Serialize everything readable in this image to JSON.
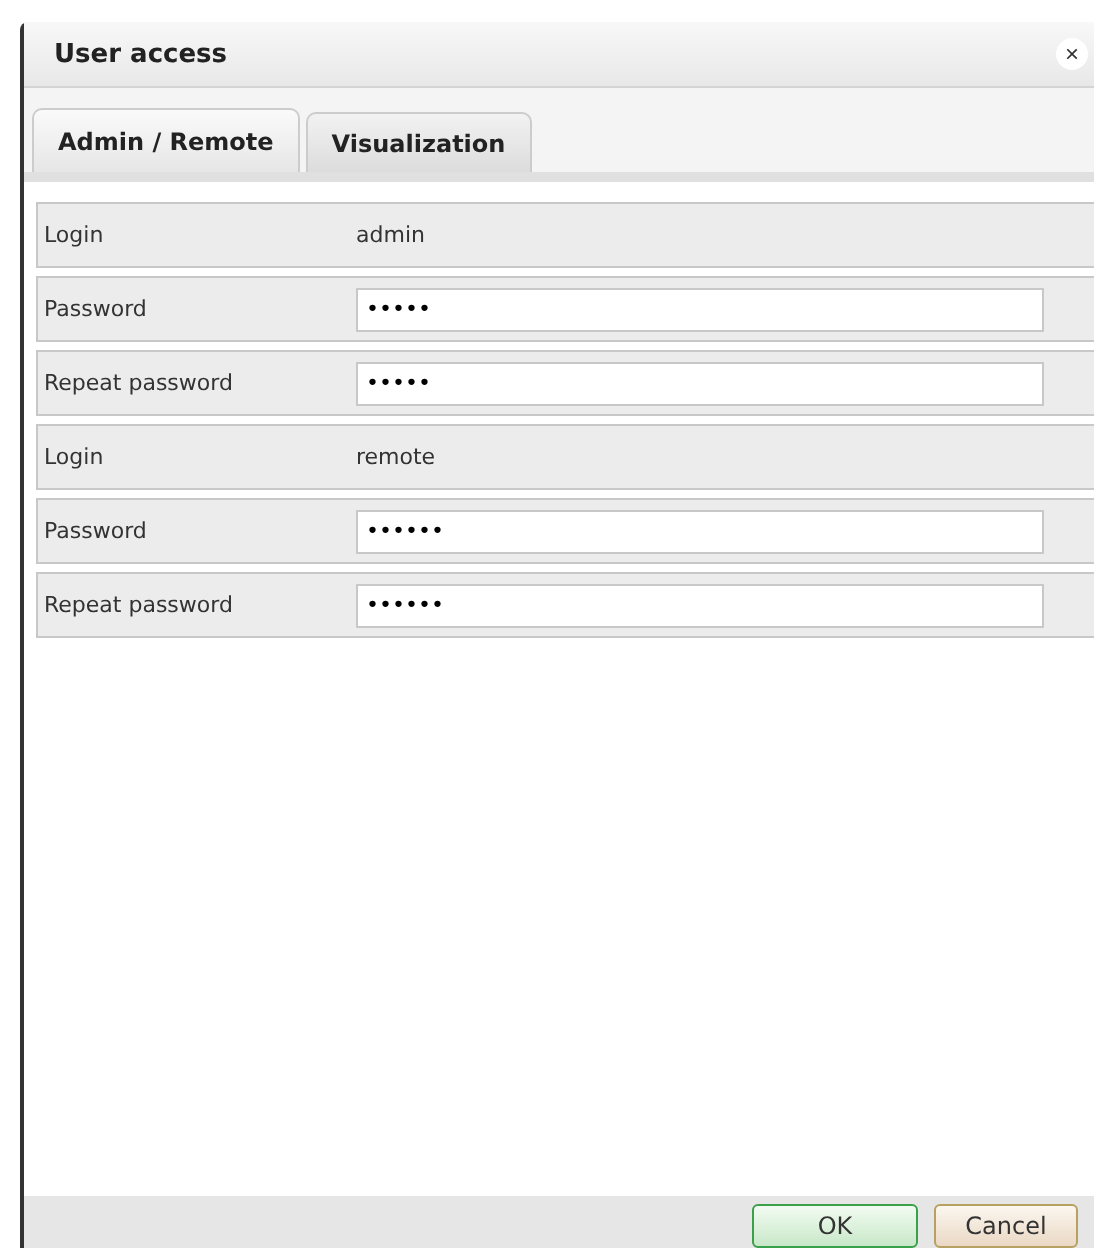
{
  "dialog": {
    "title": "User access",
    "close": "×"
  },
  "tabs": [
    {
      "label": "Admin / Remote",
      "selected": true
    },
    {
      "label": "Visualization",
      "selected": false
    }
  ],
  "rows": [
    {
      "kind": "text",
      "label": "Login",
      "value": "admin"
    },
    {
      "kind": "field",
      "label": "Password",
      "value": "•••••"
    },
    {
      "kind": "field",
      "label": "Repeat password",
      "value": "•••••"
    },
    {
      "kind": "text",
      "label": "Login",
      "value": "remote"
    },
    {
      "kind": "field",
      "label": "Password",
      "value": "••••••"
    },
    {
      "kind": "field",
      "label": "Repeat password",
      "value": "••••••"
    }
  ],
  "buttons": [
    {
      "label": "OK",
      "kind": "primary"
    },
    {
      "label": "Cancel",
      "kind": "secondary"
    }
  ]
}
